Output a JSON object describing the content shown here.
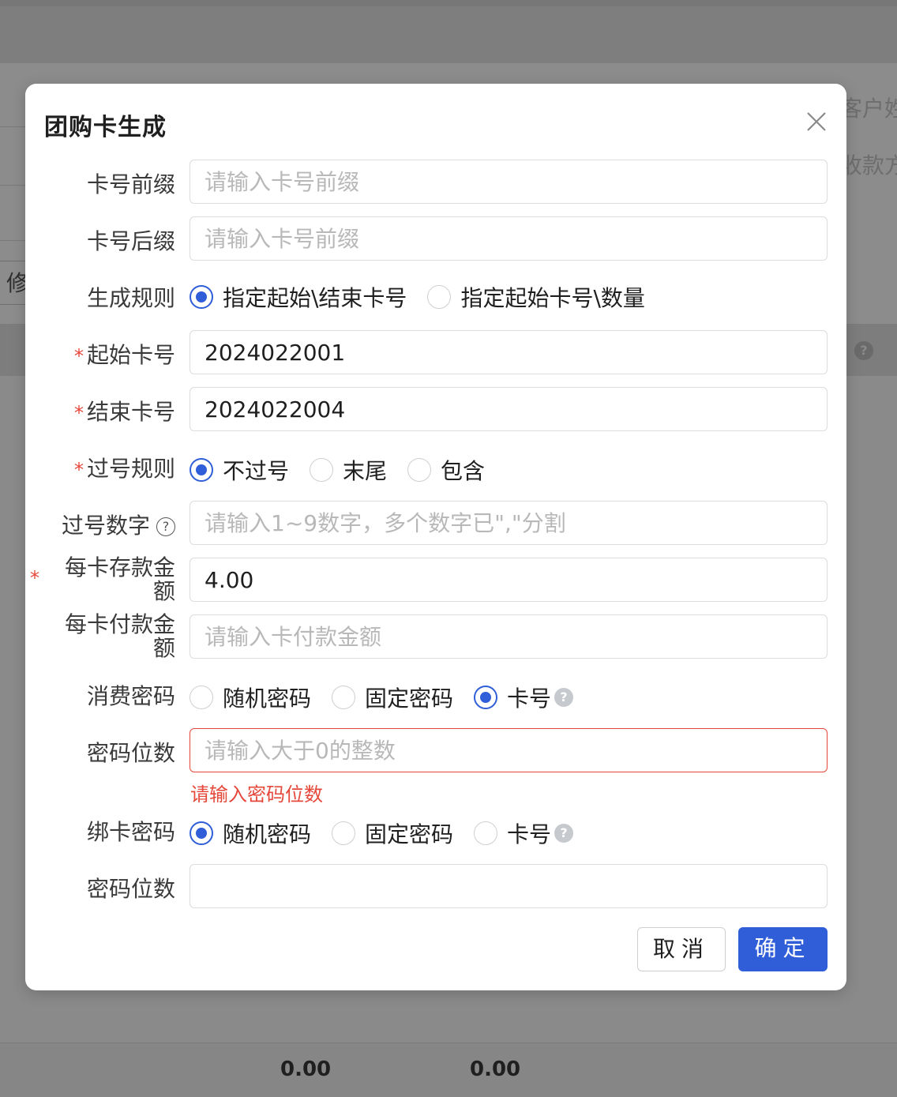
{
  "background": {
    "right_texts": [
      "客户姓",
      "收款方"
    ],
    "left_button": "修",
    "footer_values": [
      "0.00",
      "0.00"
    ]
  },
  "modal": {
    "title": "团购卡生成",
    "fields": {
      "prefix": {
        "label": "卡号前缀",
        "placeholder": "请输入卡号前缀",
        "value": ""
      },
      "suffix": {
        "label": "卡号后缀",
        "placeholder": "请输入卡号前缀",
        "value": ""
      },
      "rule": {
        "label": "生成规则",
        "options": [
          "指定起始\\结束卡号",
          "指定起始卡号\\数量"
        ],
        "selected": 0
      },
      "start_no": {
        "label": "起始卡号",
        "required": "*",
        "value": "2024022001"
      },
      "end_no": {
        "label": "结束卡号",
        "required": "*",
        "value": "2024022004"
      },
      "skip_rule": {
        "label": "过号规则",
        "required": "*",
        "options": [
          "不过号",
          "末尾",
          "包含"
        ],
        "selected": 0
      },
      "skip_digits": {
        "label": "过号数字",
        "help": "?",
        "placeholder": "请输入1~9数字，多个数字已\",\"分割",
        "value": ""
      },
      "deposit": {
        "label": "每卡存款金额",
        "required": "*",
        "value": "4.00"
      },
      "payment": {
        "label": "每卡付款金额",
        "placeholder": "请输入卡付款金额",
        "value": ""
      },
      "consume_pwd": {
        "label": "消费密码",
        "options": [
          "随机密码",
          "固定密码",
          "卡号"
        ],
        "selected": 2,
        "help": "?"
      },
      "pwd_len_1": {
        "label": "密码位数",
        "placeholder": "请输入大于0的整数",
        "value": "",
        "error": "请输入密码位数"
      },
      "bind_pwd": {
        "label": "绑卡密码",
        "options": [
          "随机密码",
          "固定密码",
          "卡号"
        ],
        "selected": 0,
        "help": "?"
      },
      "pwd_len_2": {
        "label": "密码位数",
        "placeholder": "",
        "value": ""
      }
    },
    "buttons": {
      "cancel": "取消",
      "ok": "确定"
    }
  },
  "colors": {
    "primary": "#2f5ed8",
    "error": "#e5483b",
    "overlay": "#8a8a8a"
  }
}
